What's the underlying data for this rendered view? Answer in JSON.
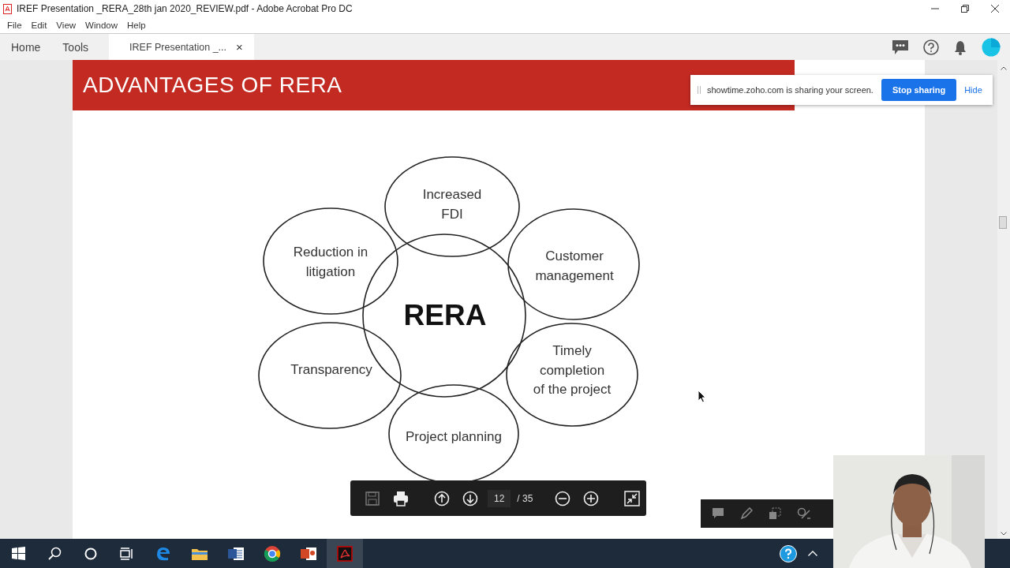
{
  "window": {
    "title": "IREF Presentation _RERA_28th jan 2020_REVIEW.pdf - Adobe Acrobat Pro DC"
  },
  "menu": [
    "File",
    "Edit",
    "View",
    "Window",
    "Help"
  ],
  "tabs": [
    {
      "label": "Home",
      "selected": false
    },
    {
      "label": "Tools",
      "selected": false
    },
    {
      "label": "IREF Presentation _...",
      "selected": true,
      "close": "×"
    }
  ],
  "slide": {
    "title": "ADVANTAGES OF RERA",
    "center": "RERA",
    "nodes": [
      {
        "lines": [
          "Increased",
          "FDI"
        ]
      },
      {
        "lines": [
          "Customer",
          "management"
        ]
      },
      {
        "lines": [
          "Timely",
          "completion",
          "of the project"
        ]
      },
      {
        "lines": [
          "Project planning"
        ]
      },
      {
        "lines": [
          "Transparency"
        ]
      },
      {
        "lines": [
          "Reduction in",
          "litigation"
        ]
      }
    ]
  },
  "share_banner": {
    "message": "showtime.zoho.com is sharing your screen.",
    "stop": "Stop sharing",
    "hide": "Hide"
  },
  "page_toolbar": {
    "buttons": [
      {
        "kind": "save",
        "disabled": true
      },
      {
        "kind": "print",
        "disabled": false
      },
      {
        "kind": "up",
        "disabled": false
      },
      {
        "kind": "down",
        "disabled": false
      },
      {
        "kind": "page"
      },
      {
        "kind": "zoom-out",
        "disabled": false
      },
      {
        "kind": "zoom-in",
        "disabled": false
      },
      {
        "kind": "fit",
        "disabled": false
      }
    ],
    "page": "12",
    "total": "/ 35"
  },
  "taskbar": {
    "apps": [
      {
        "kind": "edge",
        "selected": false
      },
      {
        "kind": "folder",
        "selected": false
      },
      {
        "kind": "word",
        "selected": false
      },
      {
        "kind": "chrome",
        "selected": false
      },
      {
        "kind": "powerpoint",
        "selected": false
      },
      {
        "kind": "acrobat",
        "selected": true
      }
    ]
  },
  "webcam": {
    "kind": "picture"
  }
}
